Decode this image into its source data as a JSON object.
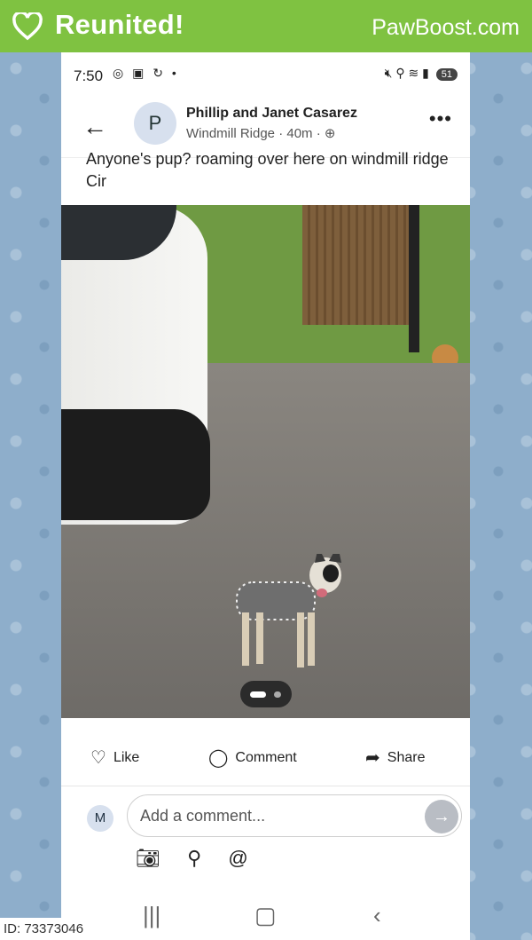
{
  "banner": {
    "title": "Reunited!",
    "brand": "PawBoost.com",
    "accent": "#7fc241"
  },
  "status_bar": {
    "time": "7:50",
    "battery": "51"
  },
  "post": {
    "author": "Phillip and Janet Casarez",
    "meta": "Windmill Ridge · 40m · ",
    "avatar_letter": "P",
    "text": "Anyone's pup? roaming over here on windmill ridge Cir"
  },
  "carousel": {
    "active_index": 0,
    "count": 2
  },
  "actions": {
    "like": "Like",
    "comment": "Comment",
    "share": "Share"
  },
  "composer": {
    "avatar_letter": "M",
    "placeholder": "Add a comment..."
  },
  "footer": {
    "id": "ID: 73373046"
  }
}
